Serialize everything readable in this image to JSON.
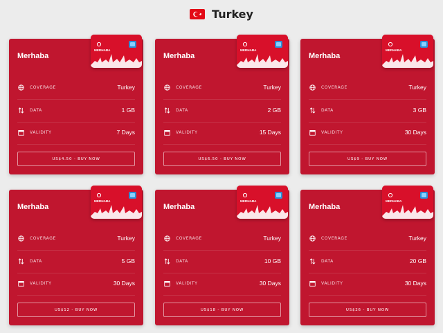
{
  "header": {
    "country": "Turkey",
    "flag_icon": "turkey-flag-icon"
  },
  "colors": {
    "card_bg": "#c0162f",
    "sim_bg": "#d8102a",
    "page_bg": "#ececec",
    "flag_red": "#e30a17"
  },
  "labels": {
    "coverage": "COVERAGE",
    "data": "DATA",
    "validity": "VALIDITY"
  },
  "cards": [
    {
      "title": "Merhaba",
      "sim_brand": "MERHABA",
      "coverage": "Turkey",
      "data": "1 GB",
      "validity": "7 Days",
      "button": "US$4.50 - BUY NOW"
    },
    {
      "title": "Merhaba",
      "sim_brand": "MERHABA",
      "coverage": "Turkey",
      "data": "2 GB",
      "validity": "15 Days",
      "button": "US$6.50 - BUY NOW"
    },
    {
      "title": "Merhaba",
      "sim_brand": "MERHABA",
      "coverage": "Turkey",
      "data": "3 GB",
      "validity": "30 Days",
      "button": "US$9 - BUY NOW"
    },
    {
      "title": "Merhaba",
      "sim_brand": "MERHABA",
      "coverage": "Turkey",
      "data": "5 GB",
      "validity": "30 Days",
      "button": "US$12 - BUY NOW"
    },
    {
      "title": "Merhaba",
      "sim_brand": "MERHABA",
      "coverage": "Turkey",
      "data": "10 GB",
      "validity": "30 Days",
      "button": "US$18 - BUY NOW"
    },
    {
      "title": "Merhaba",
      "sim_brand": "MERHABA",
      "coverage": "Turkey",
      "data": "20 GB",
      "validity": "30 Days",
      "button": "US$26 - BUY NOW"
    }
  ],
  "icons": {
    "coverage": "globe-icon",
    "data": "arrows-up-down-icon",
    "validity": "calendar-icon"
  }
}
